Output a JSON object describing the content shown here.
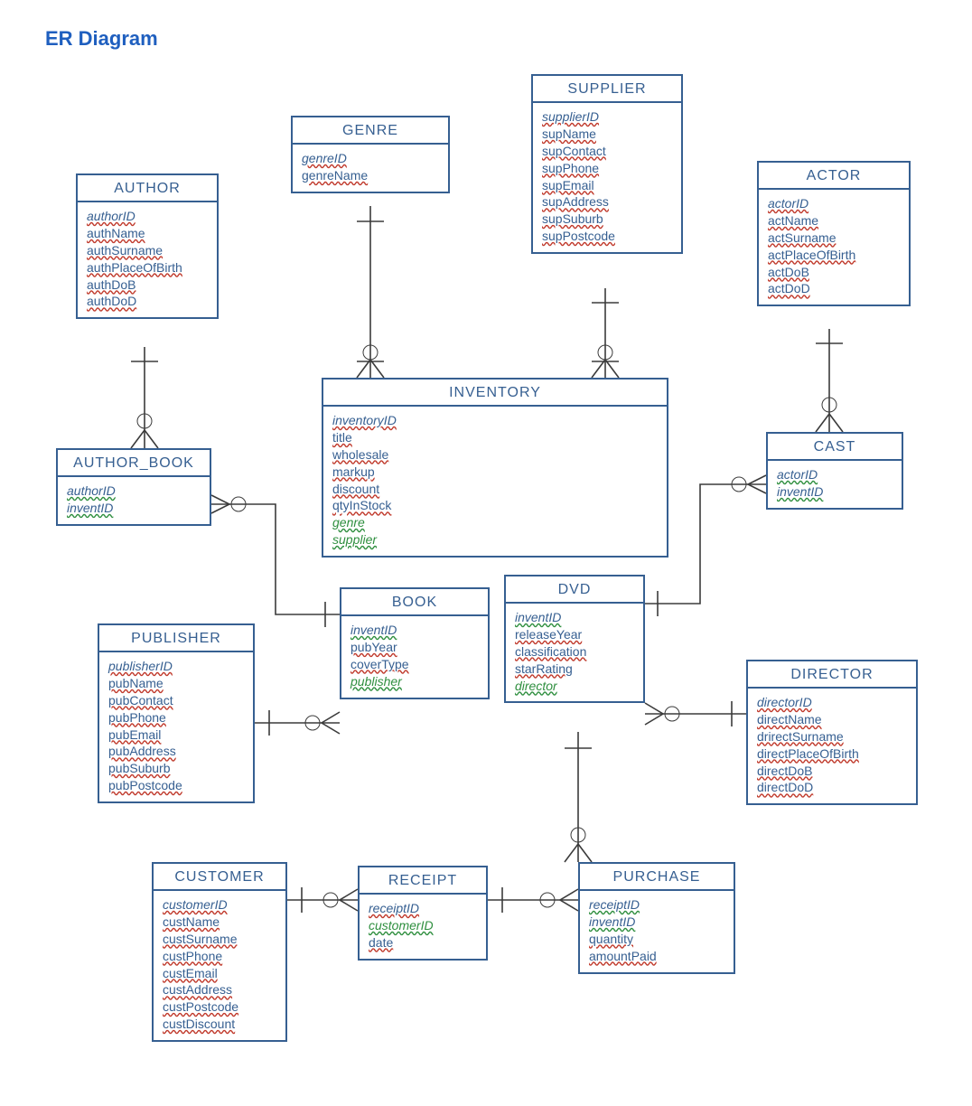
{
  "title": "ER Diagram",
  "entities": {
    "author": {
      "name": "AUTHOR",
      "attrs": [
        {
          "t": "authorID",
          "pk": true
        },
        {
          "t": "authName"
        },
        {
          "t": "authSurname"
        },
        {
          "t": "authPlaceOfBirth"
        },
        {
          "t": "authDoB"
        },
        {
          "t": "authDoD"
        }
      ]
    },
    "genre": {
      "name": "GENRE",
      "attrs": [
        {
          "t": "genreID",
          "pk": true
        },
        {
          "t": "genreName"
        }
      ]
    },
    "supplier": {
      "name": "SUPPLIER",
      "attrs": [
        {
          "t": "supplierID",
          "pk": true
        },
        {
          "t": "supName"
        },
        {
          "t": "supContact"
        },
        {
          "t": "supPhone"
        },
        {
          "t": "supEmail"
        },
        {
          "t": "supAddress"
        },
        {
          "t": "supSuburb"
        },
        {
          "t": "supPostcode"
        }
      ]
    },
    "actor": {
      "name": "ACTOR",
      "attrs": [
        {
          "t": "actorID",
          "pk": true
        },
        {
          "t": "actName"
        },
        {
          "t": "actSurname"
        },
        {
          "t": "actPlaceOfBirth"
        },
        {
          "t": "actDoB"
        },
        {
          "t": "actDoD"
        }
      ]
    },
    "author_book": {
      "name": "AUTHOR_BOOK",
      "attrs": [
        {
          "t": "authorID",
          "pk": true,
          "fk": true
        },
        {
          "t": "inventID",
          "pk": true,
          "fk": true
        }
      ]
    },
    "inventory": {
      "name": "INVENTORY",
      "attrs": [
        {
          "t": "inventoryID",
          "pk": true
        },
        {
          "t": "title"
        },
        {
          "t": "wholesale"
        },
        {
          "t": "markup"
        },
        {
          "t": "discount"
        },
        {
          "t": "qtyInStock"
        },
        {
          "t": "genre",
          "fk": true
        },
        {
          "t": "supplier",
          "fk": true
        }
      ]
    },
    "cast": {
      "name": "CAST",
      "attrs": [
        {
          "t": "actorID",
          "pk": true,
          "fk": true
        },
        {
          "t": "inventID",
          "pk": true,
          "fk": true
        }
      ]
    },
    "book": {
      "name": "BOOK",
      "attrs": [
        {
          "t": "inventID",
          "pk": true,
          "fk": true
        },
        {
          "t": "pubYear"
        },
        {
          "t": "coverType"
        },
        {
          "t": "publisher",
          "fk": true
        }
      ]
    },
    "dvd": {
      "name": "DVD",
      "attrs": [
        {
          "t": "inventID",
          "pk": true,
          "fk": true
        },
        {
          "t": "releaseYear"
        },
        {
          "t": "classification"
        },
        {
          "t": "starRating"
        },
        {
          "t": "director",
          "fk": true
        }
      ]
    },
    "publisher": {
      "name": "PUBLISHER",
      "attrs": [
        {
          "t": "publisherID",
          "pk": true
        },
        {
          "t": "pubName"
        },
        {
          "t": "pubContact"
        },
        {
          "t": "pubPhone"
        },
        {
          "t": "pubEmail"
        },
        {
          "t": "pubAddress"
        },
        {
          "t": "pubSuburb"
        },
        {
          "t": "pubPostcode"
        }
      ]
    },
    "director": {
      "name": "DIRECTOR",
      "attrs": [
        {
          "t": "directorID",
          "pk": true
        },
        {
          "t": "directName"
        },
        {
          "t": "drirectSurname"
        },
        {
          "t": "directPlaceOfBirth"
        },
        {
          "t": "directDoB"
        },
        {
          "t": "directDoD"
        }
      ]
    },
    "customer": {
      "name": "CUSTOMER",
      "attrs": [
        {
          "t": "customerID",
          "pk": true
        },
        {
          "t": "custName"
        },
        {
          "t": "custSurname"
        },
        {
          "t": "custPhone"
        },
        {
          "t": "custEmail"
        },
        {
          "t": "custAddress"
        },
        {
          "t": "custPostcode"
        },
        {
          "t": "custDiscount"
        }
      ]
    },
    "receipt": {
      "name": "RECEIPT",
      "attrs": [
        {
          "t": "receiptID",
          "pk": true
        },
        {
          "t": "customerID",
          "fk": true
        },
        {
          "t": "date"
        }
      ]
    },
    "purchase": {
      "name": "PURCHASE",
      "attrs": [
        {
          "t": "receiptID",
          "pk": true,
          "fk": true
        },
        {
          "t": "inventID",
          "pk": true,
          "fk": true
        },
        {
          "t": "quantity"
        },
        {
          "t": "amountPaid"
        }
      ]
    }
  }
}
